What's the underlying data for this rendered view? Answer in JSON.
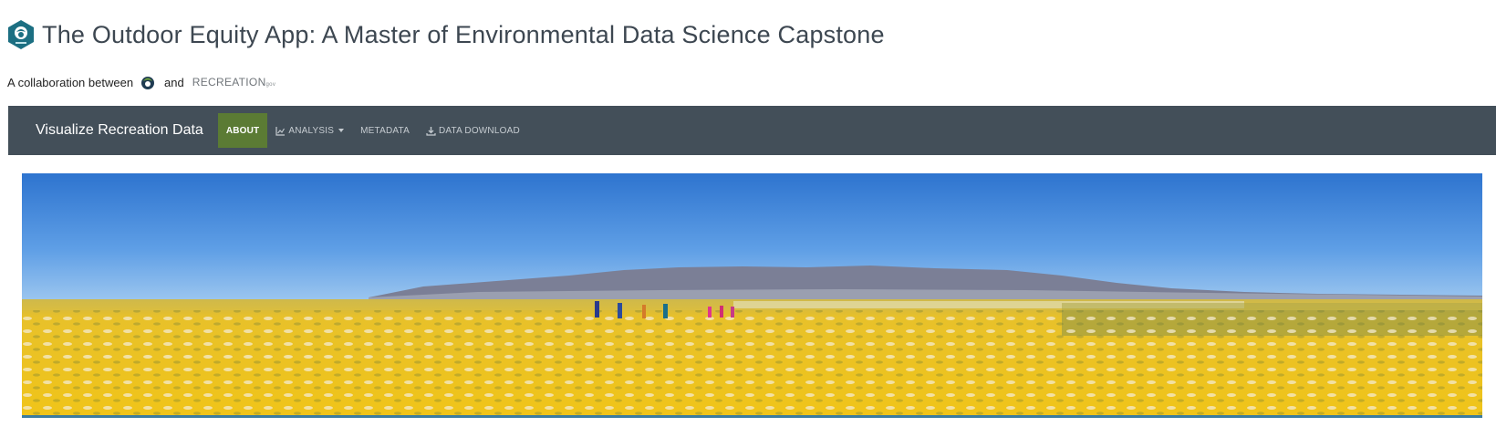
{
  "header": {
    "title": "The Outdoor Equity App: A Master of Environmental Data Science Capstone",
    "logo_icon": "meds-hex-logo-icon"
  },
  "collab": {
    "prefix": "A collaboration between",
    "and": "and",
    "partner1_icon": "meds-leaf-logo-icon",
    "partner2_text": "RECREATION",
    "partner2_suffix": "gov"
  },
  "navbar": {
    "brand": "Visualize Recreation Data",
    "items": [
      {
        "label": "ABOUT",
        "icon": "",
        "active": true
      },
      {
        "label": "ANALYSIS",
        "icon": "chart-icon",
        "dropdown": true
      },
      {
        "label": "METADATA",
        "icon": ""
      },
      {
        "label": "DATA DOWNLOAD",
        "icon": "download-icon"
      }
    ]
  },
  "banner": {
    "image": "panorama of hikers in yellow wildflower field under blue sky"
  },
  "colors": {
    "navbar_bg": "#434f59",
    "active_tab": "#5b7b34",
    "title_text": "#3d4751",
    "teal_logo": "#1c6f82"
  }
}
